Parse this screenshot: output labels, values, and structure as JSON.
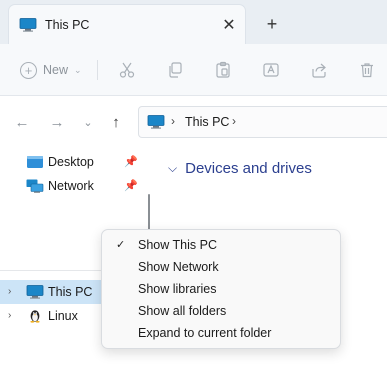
{
  "tab": {
    "title": "This PC",
    "close_icon": "close-icon",
    "new_tab_icon": "plus-icon"
  },
  "toolbar": {
    "new_label": "New",
    "buttons": [
      "cut-icon",
      "copy-icon",
      "paste-icon",
      "rename-icon",
      "share-icon",
      "delete-icon"
    ]
  },
  "address": {
    "path": [
      "This PC"
    ]
  },
  "sidebar": {
    "pinned": [
      {
        "label": "Desktop",
        "icon": "desktop-folder-icon"
      },
      {
        "label": "Network",
        "icon": "network-icon"
      }
    ],
    "drives": [
      {
        "label": "This PC",
        "icon": "computer-icon"
      },
      {
        "label": "Linux",
        "icon": "linux-penguin-icon"
      }
    ]
  },
  "main": {
    "group_title": "Devices and drives"
  },
  "context_menu": {
    "items": [
      {
        "label": "Show This PC",
        "checked": true
      },
      {
        "label": "Show Network",
        "checked": false
      },
      {
        "label": "Show libraries",
        "checked": false
      },
      {
        "label": "Show all folders",
        "checked": false
      },
      {
        "label": "Expand to current folder",
        "checked": false
      }
    ]
  },
  "colors": {
    "accent": "#2b3f8f",
    "selection": "#cce4f7",
    "monitor": "#1b86c8"
  }
}
